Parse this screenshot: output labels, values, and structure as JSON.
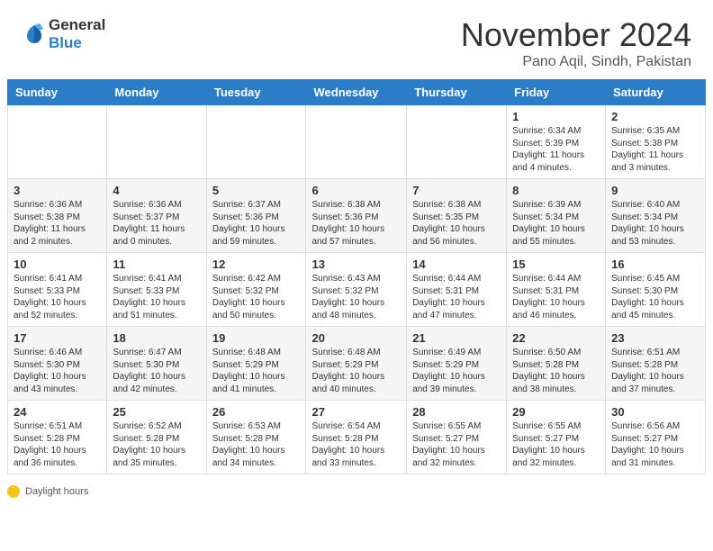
{
  "header": {
    "logo_general": "General",
    "logo_blue": "Blue",
    "month": "November 2024",
    "location": "Pano Aqil, Sindh, Pakistan"
  },
  "days_of_week": [
    "Sunday",
    "Monday",
    "Tuesday",
    "Wednesday",
    "Thursday",
    "Friday",
    "Saturday"
  ],
  "weeks": [
    {
      "row_alt": false,
      "days": [
        {
          "num": "",
          "info": ""
        },
        {
          "num": "",
          "info": ""
        },
        {
          "num": "",
          "info": ""
        },
        {
          "num": "",
          "info": ""
        },
        {
          "num": "",
          "info": ""
        },
        {
          "num": "1",
          "info": "Sunrise: 6:34 AM\nSunset: 5:39 PM\nDaylight: 11 hours and 4 minutes."
        },
        {
          "num": "2",
          "info": "Sunrise: 6:35 AM\nSunset: 5:38 PM\nDaylight: 11 hours and 3 minutes."
        }
      ]
    },
    {
      "row_alt": true,
      "days": [
        {
          "num": "3",
          "info": "Sunrise: 6:36 AM\nSunset: 5:38 PM\nDaylight: 11 hours and 2 minutes."
        },
        {
          "num": "4",
          "info": "Sunrise: 6:36 AM\nSunset: 5:37 PM\nDaylight: 11 hours and 0 minutes."
        },
        {
          "num": "5",
          "info": "Sunrise: 6:37 AM\nSunset: 5:36 PM\nDaylight: 10 hours and 59 minutes."
        },
        {
          "num": "6",
          "info": "Sunrise: 6:38 AM\nSunset: 5:36 PM\nDaylight: 10 hours and 57 minutes."
        },
        {
          "num": "7",
          "info": "Sunrise: 6:38 AM\nSunset: 5:35 PM\nDaylight: 10 hours and 56 minutes."
        },
        {
          "num": "8",
          "info": "Sunrise: 6:39 AM\nSunset: 5:34 PM\nDaylight: 10 hours and 55 minutes."
        },
        {
          "num": "9",
          "info": "Sunrise: 6:40 AM\nSunset: 5:34 PM\nDaylight: 10 hours and 53 minutes."
        }
      ]
    },
    {
      "row_alt": false,
      "days": [
        {
          "num": "10",
          "info": "Sunrise: 6:41 AM\nSunset: 5:33 PM\nDaylight: 10 hours and 52 minutes."
        },
        {
          "num": "11",
          "info": "Sunrise: 6:41 AM\nSunset: 5:33 PM\nDaylight: 10 hours and 51 minutes."
        },
        {
          "num": "12",
          "info": "Sunrise: 6:42 AM\nSunset: 5:32 PM\nDaylight: 10 hours and 50 minutes."
        },
        {
          "num": "13",
          "info": "Sunrise: 6:43 AM\nSunset: 5:32 PM\nDaylight: 10 hours and 48 minutes."
        },
        {
          "num": "14",
          "info": "Sunrise: 6:44 AM\nSunset: 5:31 PM\nDaylight: 10 hours and 47 minutes."
        },
        {
          "num": "15",
          "info": "Sunrise: 6:44 AM\nSunset: 5:31 PM\nDaylight: 10 hours and 46 minutes."
        },
        {
          "num": "16",
          "info": "Sunrise: 6:45 AM\nSunset: 5:30 PM\nDaylight: 10 hours and 45 minutes."
        }
      ]
    },
    {
      "row_alt": true,
      "days": [
        {
          "num": "17",
          "info": "Sunrise: 6:46 AM\nSunset: 5:30 PM\nDaylight: 10 hours and 43 minutes."
        },
        {
          "num": "18",
          "info": "Sunrise: 6:47 AM\nSunset: 5:30 PM\nDaylight: 10 hours and 42 minutes."
        },
        {
          "num": "19",
          "info": "Sunrise: 6:48 AM\nSunset: 5:29 PM\nDaylight: 10 hours and 41 minutes."
        },
        {
          "num": "20",
          "info": "Sunrise: 6:48 AM\nSunset: 5:29 PM\nDaylight: 10 hours and 40 minutes."
        },
        {
          "num": "21",
          "info": "Sunrise: 6:49 AM\nSunset: 5:29 PM\nDaylight: 10 hours and 39 minutes."
        },
        {
          "num": "22",
          "info": "Sunrise: 6:50 AM\nSunset: 5:28 PM\nDaylight: 10 hours and 38 minutes."
        },
        {
          "num": "23",
          "info": "Sunrise: 6:51 AM\nSunset: 5:28 PM\nDaylight: 10 hours and 37 minutes."
        }
      ]
    },
    {
      "row_alt": false,
      "days": [
        {
          "num": "24",
          "info": "Sunrise: 6:51 AM\nSunset: 5:28 PM\nDaylight: 10 hours and 36 minutes."
        },
        {
          "num": "25",
          "info": "Sunrise: 6:52 AM\nSunset: 5:28 PM\nDaylight: 10 hours and 35 minutes."
        },
        {
          "num": "26",
          "info": "Sunrise: 6:53 AM\nSunset: 5:28 PM\nDaylight: 10 hours and 34 minutes."
        },
        {
          "num": "27",
          "info": "Sunrise: 6:54 AM\nSunset: 5:28 PM\nDaylight: 10 hours and 33 minutes."
        },
        {
          "num": "28",
          "info": "Sunrise: 6:55 AM\nSunset: 5:27 PM\nDaylight: 10 hours and 32 minutes."
        },
        {
          "num": "29",
          "info": "Sunrise: 6:55 AM\nSunset: 5:27 PM\nDaylight: 10 hours and 32 minutes."
        },
        {
          "num": "30",
          "info": "Sunrise: 6:56 AM\nSunset: 5:27 PM\nDaylight: 10 hours and 31 minutes."
        }
      ]
    }
  ],
  "legend": {
    "daylight_label": "Daylight hours"
  }
}
